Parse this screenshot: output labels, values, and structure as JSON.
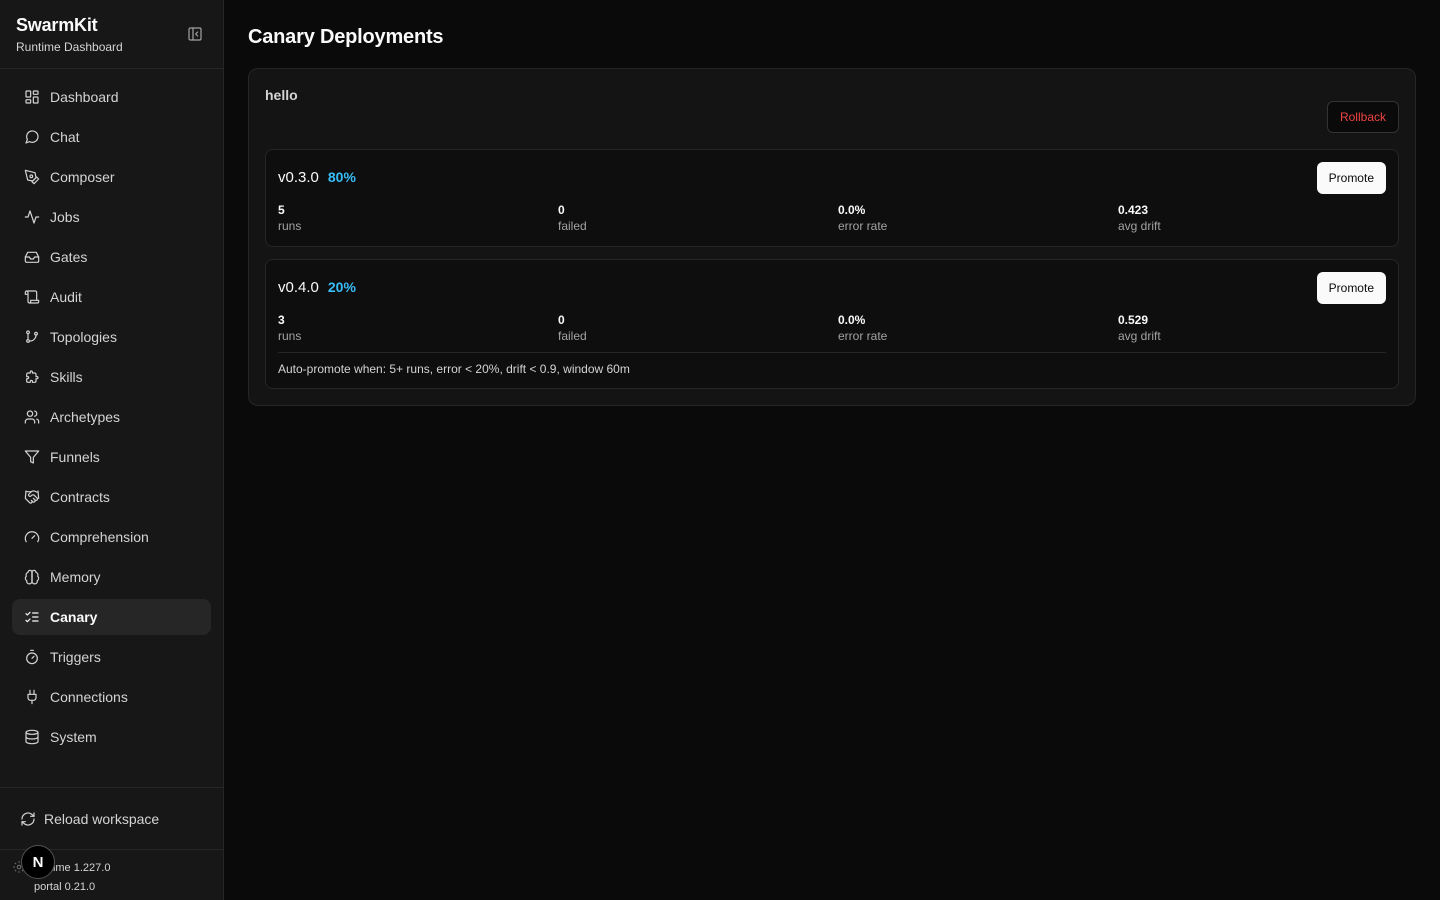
{
  "sidebar": {
    "brand_title": "SwarmKit",
    "brand_subtitle": "Runtime Dashboard",
    "items": [
      {
        "label": "Dashboard",
        "icon": "layout-dashboard-icon"
      },
      {
        "label": "Chat",
        "icon": "message-circle-icon"
      },
      {
        "label": "Composer",
        "icon": "pen-tool-icon"
      },
      {
        "label": "Jobs",
        "icon": "activity-icon"
      },
      {
        "label": "Gates",
        "icon": "inbox-icon"
      },
      {
        "label": "Audit",
        "icon": "scroll-icon"
      },
      {
        "label": "Topologies",
        "icon": "git-branch-icon"
      },
      {
        "label": "Skills",
        "icon": "puzzle-icon"
      },
      {
        "label": "Archetypes",
        "icon": "users-icon"
      },
      {
        "label": "Funnels",
        "icon": "filter-icon"
      },
      {
        "label": "Contracts",
        "icon": "handshake-icon"
      },
      {
        "label": "Comprehension",
        "icon": "gauge-icon"
      },
      {
        "label": "Memory",
        "icon": "brain-icon"
      },
      {
        "label": "Canary",
        "icon": "list-checks-icon"
      },
      {
        "label": "Triggers",
        "icon": "timer-icon"
      },
      {
        "label": "Connections",
        "icon": "plug-icon"
      },
      {
        "label": "System",
        "icon": "database-icon"
      }
    ],
    "active": "Canary",
    "reload_label": "Reload workspace",
    "runtime_version": "runtime 1.227.0",
    "portal_version": "portal 0.21.0",
    "avatar_letter": "N"
  },
  "main": {
    "title": "Canary Deployments",
    "group": {
      "name": "hello",
      "rollback_label": "Rollback",
      "versions": [
        {
          "version": "v0.3.0",
          "percent": "80%",
          "promote_label": "Promote",
          "stats": [
            {
              "value": "5",
              "label": "runs"
            },
            {
              "value": "0",
              "label": "failed"
            },
            {
              "value": "0.0%",
              "label": "error rate"
            },
            {
              "value": "0.423",
              "label": "avg drift"
            }
          ]
        },
        {
          "version": "v0.4.0",
          "percent": "20%",
          "promote_label": "Promote",
          "stats": [
            {
              "value": "3",
              "label": "runs"
            },
            {
              "value": "0",
              "label": "failed"
            },
            {
              "value": "0.0%",
              "label": "error rate"
            },
            {
              "value": "0.529",
              "label": "avg drift"
            }
          ]
        }
      ],
      "auto_promote": "Auto-promote when: 5+ runs, error < 20%, drift < 0.9, window 60m"
    }
  },
  "colors": {
    "accent_percent": "#38bdf8",
    "rollback": "#ef4444",
    "background": "#0a0a0a",
    "sidebar": "#171717"
  }
}
